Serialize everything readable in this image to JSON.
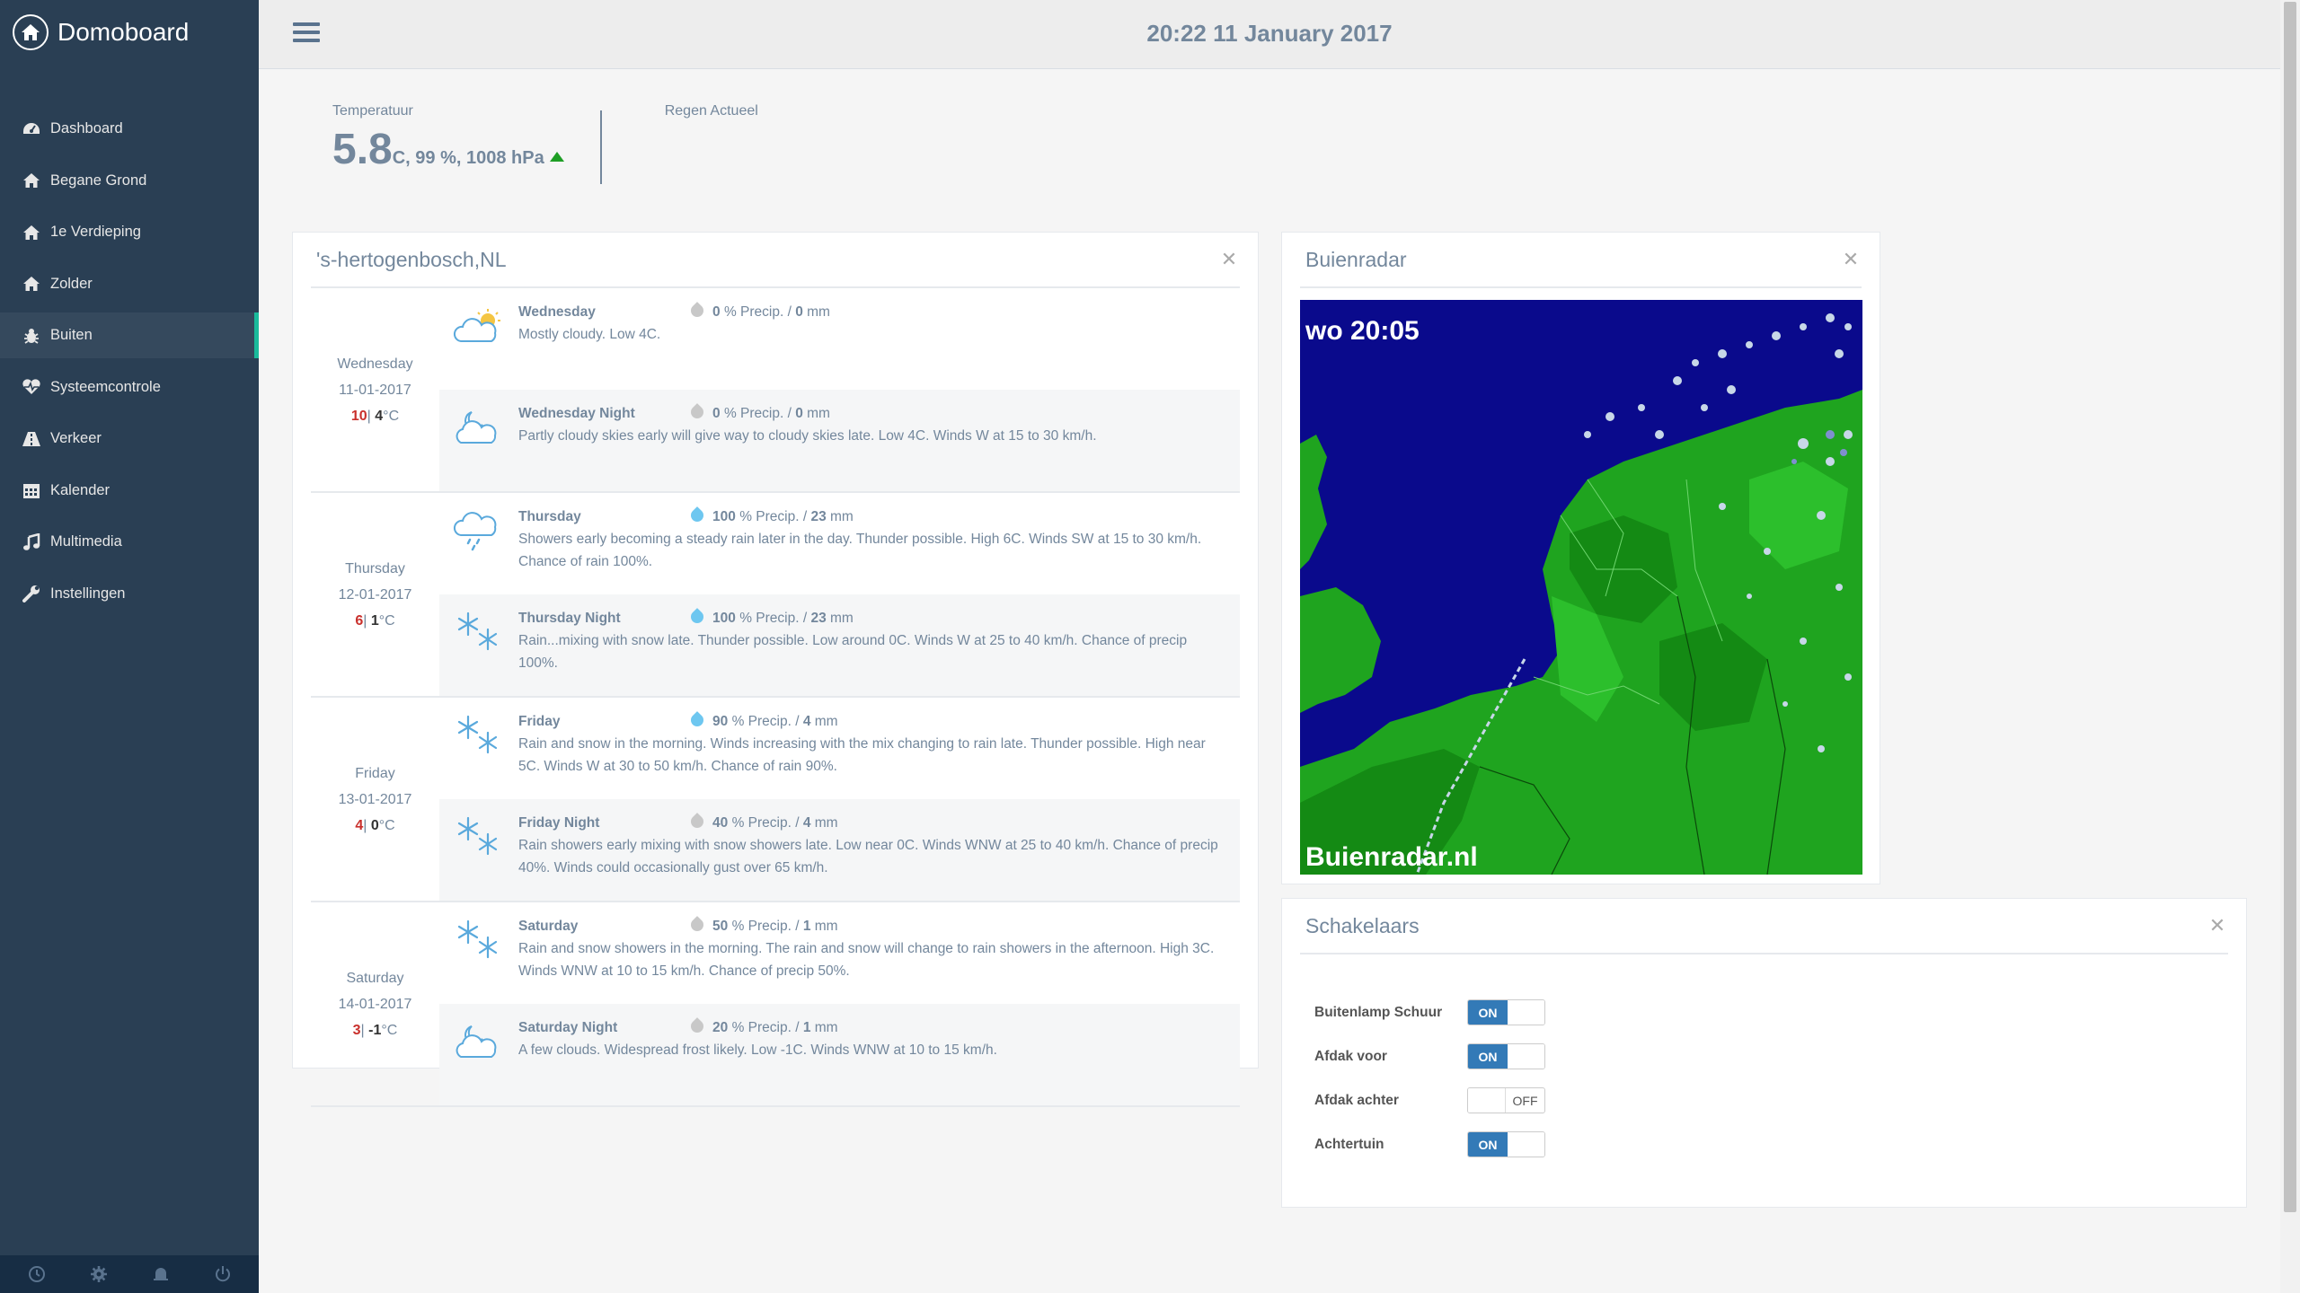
{
  "brand": {
    "title": "Domoboard"
  },
  "sidebar": {
    "items": [
      {
        "label": "Dashboard",
        "icon": "dashboard-icon"
      },
      {
        "label": "Begane Grond",
        "icon": "home-icon"
      },
      {
        "label": "1e Verdieping",
        "icon": "home-icon"
      },
      {
        "label": "Zolder",
        "icon": "home-icon"
      },
      {
        "label": "Buiten",
        "icon": "bug-icon",
        "active": true
      },
      {
        "label": "Systeemcontrole",
        "icon": "heartbeat-icon"
      },
      {
        "label": "Verkeer",
        "icon": "road-icon"
      },
      {
        "label": "Kalender",
        "icon": "calendar-icon"
      },
      {
        "label": "Multimedia",
        "icon": "music-icon"
      },
      {
        "label": "Instellingen",
        "icon": "wrench-icon"
      }
    ],
    "footer": [
      "clock-icon",
      "gear-icon",
      "bell-icon",
      "power-icon"
    ]
  },
  "topbar": {
    "clock": "20:22 11 January 2017"
  },
  "tiles": {
    "temp_label": "Temperatuur",
    "temp_value": "5.8",
    "temp_rest": "C, 99 %, 1008 hPa",
    "rain_label": "Regen Actueel"
  },
  "weather": {
    "title": "'s-hertogenbosch,NL",
    "days": [
      {
        "day": "Wednesday",
        "date": "11-01-2017",
        "high": "10",
        "low": "4",
        "unit": "°C",
        "periods": [
          {
            "name": "Wednesday",
            "pct": "0",
            "mm": "0",
            "desc": "Mostly cloudy. Low 4C.",
            "icon": "partly-sunny-icon"
          },
          {
            "name": "Wednesday Night",
            "pct": "0",
            "mm": "0",
            "desc": "Partly cloudy skies early will give way to cloudy skies late. Low 4C. Winds W at 15 to 30 km/h.",
            "icon": "cloudy-night-icon"
          }
        ]
      },
      {
        "day": "Thursday",
        "date": "12-01-2017",
        "high": "6",
        "low": "1",
        "unit": "°C",
        "periods": [
          {
            "name": "Thursday",
            "pct": "100",
            "mm": "23",
            "desc": "Showers early becoming a steady rain later in the day. Thunder possible. High 6C. Winds SW at 15 to 30 km/h. Chance of rain 100%.",
            "icon": "rain-cloud-icon"
          },
          {
            "name": "Thursday Night",
            "pct": "100",
            "mm": "23",
            "desc": "Rain...mixing with snow late. Thunder possible. Low around 0C. Winds W at 25 to 40 km/h. Chance of precip 100%.",
            "icon": "snowflake-icon"
          }
        ]
      },
      {
        "day": "Friday",
        "date": "13-01-2017",
        "high": "4",
        "low": "0",
        "unit": "°C",
        "periods": [
          {
            "name": "Friday",
            "pct": "90",
            "mm": "4",
            "desc": "Rain and snow in the morning. Winds increasing with the mix changing to rain late. Thunder possible. High near 5C. Winds W at 30 to 50 km/h. Chance of rain 90%.",
            "icon": "snowflake-icon"
          },
          {
            "name": "Friday Night",
            "pct": "40",
            "mm": "4",
            "desc": "Rain showers early mixing with snow showers late. Low near 0C. Winds WNW at 25 to 40 km/h. Chance of precip 40%. Winds could occasionally gust over 65 km/h.",
            "icon": "snowflake-icon"
          }
        ]
      },
      {
        "day": "Saturday",
        "date": "14-01-2017",
        "high": "3",
        "low": "-1",
        "unit": "°C",
        "periods": [
          {
            "name": "Saturday",
            "pct": "50",
            "mm": "1",
            "desc": "Rain and snow showers in the morning. The rain and snow will change to rain showers in the afternoon. High 3C. Winds WNW at 10 to 15 km/h. Chance of precip 50%.",
            "icon": "snowflake-icon"
          },
          {
            "name": "Saturday Night",
            "pct": "20",
            "mm": "1",
            "desc": "A few clouds. Widespread frost likely. Low -1C. Winds WNW at 10 to 15 km/h.",
            "icon": "cloudy-night-icon"
          }
        ]
      }
    ],
    "precip_label": "% Precip. /",
    "mm_label": "mm"
  },
  "radar": {
    "title": "Buienradar",
    "time": "wo 20:05",
    "brand": "Buienradar.nl"
  },
  "switches": {
    "title": "Schakelaars",
    "items": [
      {
        "label": "Buitenlamp Schuur",
        "state": "ON"
      },
      {
        "label": "Afdak voor",
        "state": "ON"
      },
      {
        "label": "Afdak achter",
        "state": "OFF"
      },
      {
        "label": "Achtertuin",
        "state": "ON"
      }
    ]
  },
  "colors": {
    "sidebar": "#2a3f54",
    "accent": "#1abb9c",
    "switch_on": "#337ab7",
    "radar_sea": "#0a0a8c",
    "radar_land": "#1fa41f"
  }
}
